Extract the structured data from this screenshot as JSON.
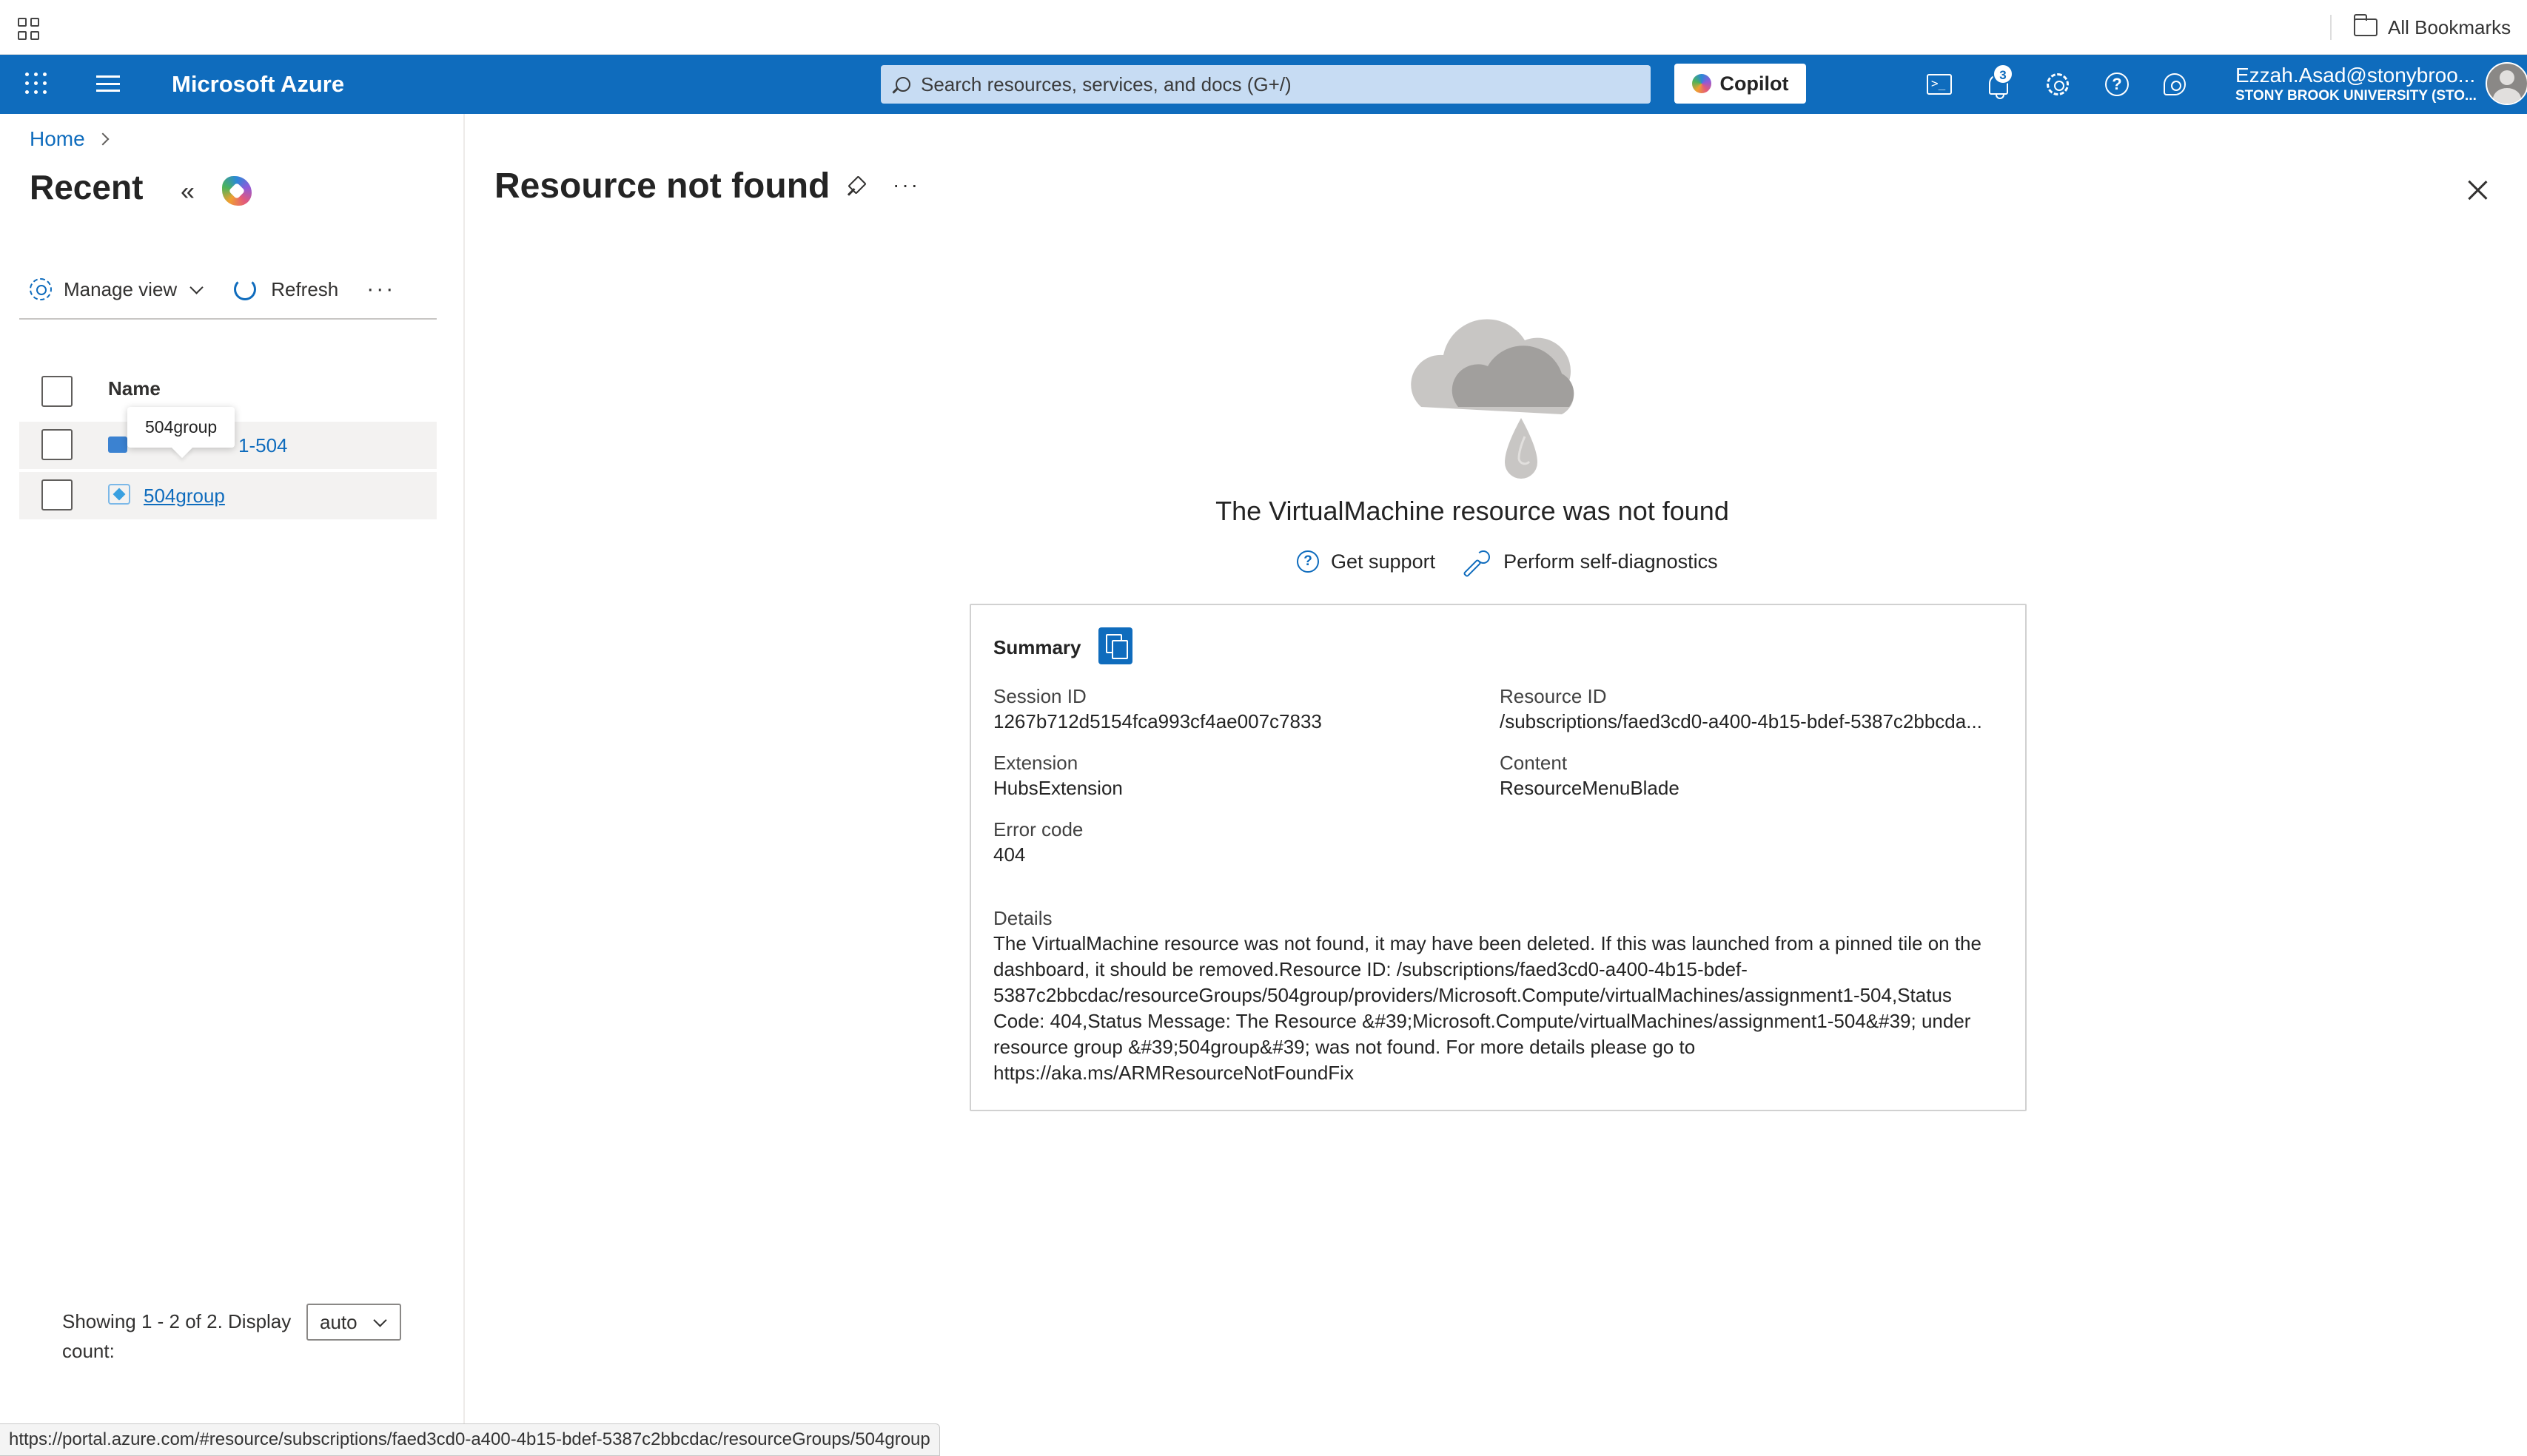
{
  "browser": {
    "bookmarks_label": "All Bookmarks"
  },
  "topnav": {
    "brand": "Microsoft Azure",
    "search_placeholder": "Search resources, services, and docs (G+/)",
    "copilot_label": "Copilot",
    "notifications_count": "3",
    "user_email": "Ezzah.Asad@stonybroo...",
    "user_org": "STONY BROOK UNIVERSITY (STO..."
  },
  "breadcrumb": {
    "home": "Home"
  },
  "recent": {
    "title": "Recent",
    "toolbar": {
      "manage_view": "Manage view",
      "refresh": "Refresh",
      "more": "···"
    },
    "column_name": "Name",
    "rows": [
      {
        "name_visible": "1-504",
        "icon": "virtual-machine-icon"
      },
      {
        "name_visible": "504group",
        "icon": "resource-group-icon"
      }
    ],
    "tooltip": "504group",
    "footer_text": "Showing 1 - 2 of 2. Display count:",
    "display_count": "auto"
  },
  "blade": {
    "title": "Resource not found",
    "more": "···",
    "error_heading": "The VirtualMachine resource was not found",
    "get_support": "Get support",
    "self_diagnostics": "Perform self-diagnostics",
    "summary": {
      "title": "Summary",
      "session_id_label": "Session ID",
      "session_id": "1267b712d5154fca993cf4ae007c7833",
      "resource_id_label": "Resource ID",
      "resource_id": "/subscriptions/faed3cd0-a400-4b15-bdef-5387c2bbcda...",
      "extension_label": "Extension",
      "extension": "HubsExtension",
      "content_label": "Content",
      "content": "ResourceMenuBlade",
      "error_code_label": "Error code",
      "error_code": "404",
      "details_label": "Details",
      "details": "The VirtualMachine resource was not found, it may have been deleted. If this was launched from a pinned tile on the dashboard, it should be removed.Resource ID: /subscriptions/faed3cd0-a400-4b15-bdef-5387c2bbcdac/resourceGroups/504group/providers/Microsoft.Compute/virtualMachines/assignment1-504,Status Code: 404,Status Message: The Resource &#39;Microsoft.Compute/virtualMachines/assignment1-504&#39; under resource group &#39;504group&#39; was not found. For more details please go to https://aka.ms/ARMResourceNotFoundFix"
    }
  },
  "status_bar": {
    "url": "https://portal.azure.com/#resource/subscriptions/faed3cd0-a400-4b15-bdef-5387c2bbcdac/resourceGroups/504group"
  },
  "colors": {
    "azure_blue": "#0f6cbd",
    "search_bg": "#c7dcf3",
    "row_hover": "#f3f2f1"
  }
}
